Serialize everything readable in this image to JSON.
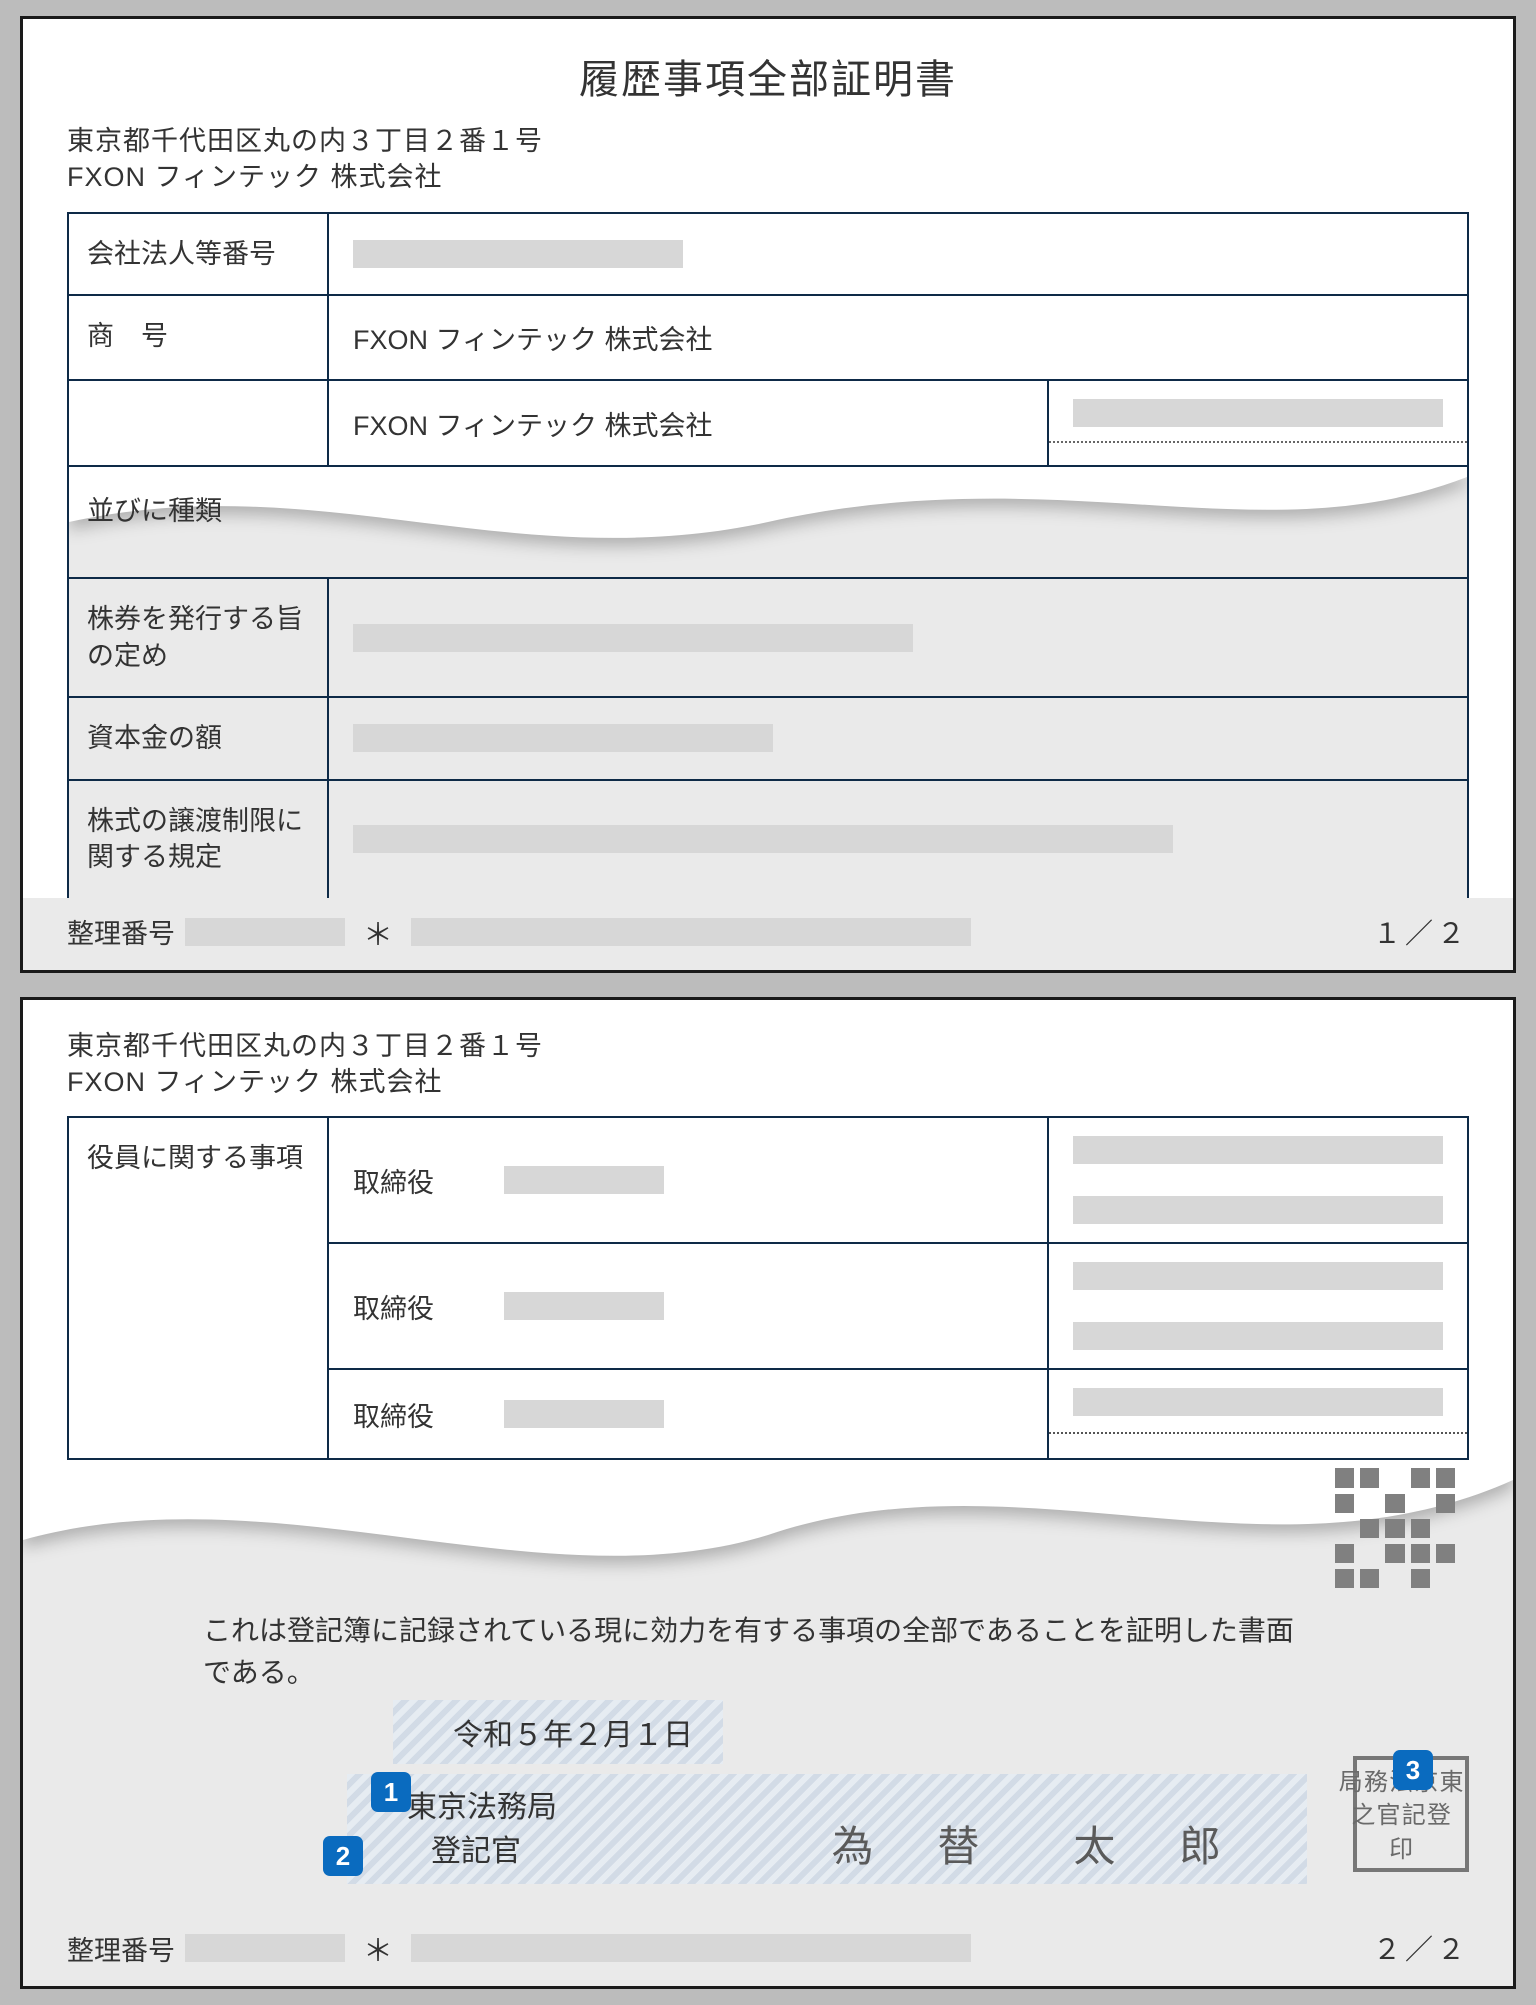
{
  "doc_title": "履歴事項全部証明書",
  "address_line": "東京都千代田区丸の内３丁目２番１号",
  "company_name": "FXON フィンテック 株式会社",
  "page1": {
    "rows": {
      "corp_number_label": "会社法人等番号",
      "trade_name_label": "商　号",
      "trade_name_value": "FXON フィンテック 株式会社",
      "trade_name_value2": "FXON フィンテック 株式会社",
      "narabi_label": "並びに種類",
      "stock_issue_label": "株券を発行する旨の定め",
      "capital_label": "資本金の額",
      "transfer_restrict_label": "株式の譲渡制限に関する規定"
    },
    "footer": {
      "seiri_label": "整理番号",
      "asterisk": "＊",
      "page": "１／２"
    }
  },
  "page2": {
    "officers_label": "役員に関する事項",
    "director_label": "取締役",
    "cert_text": "これは登記簿に記録されている現に効力を有する事項の全部であることを証明した書面である。",
    "date_text": "令和５年２月１日",
    "bureau": "東京法務局",
    "registrar": "登記官",
    "officer_name": "為 替　太 郎",
    "badges": {
      "b1": "1",
      "b2": "2",
      "b3": "3"
    },
    "seal_cols": [
      "東京法務局",
      "登記官之",
      "印"
    ],
    "footer": {
      "seiri_label": "整理番号",
      "asterisk": "＊",
      "page": "２／２"
    }
  }
}
